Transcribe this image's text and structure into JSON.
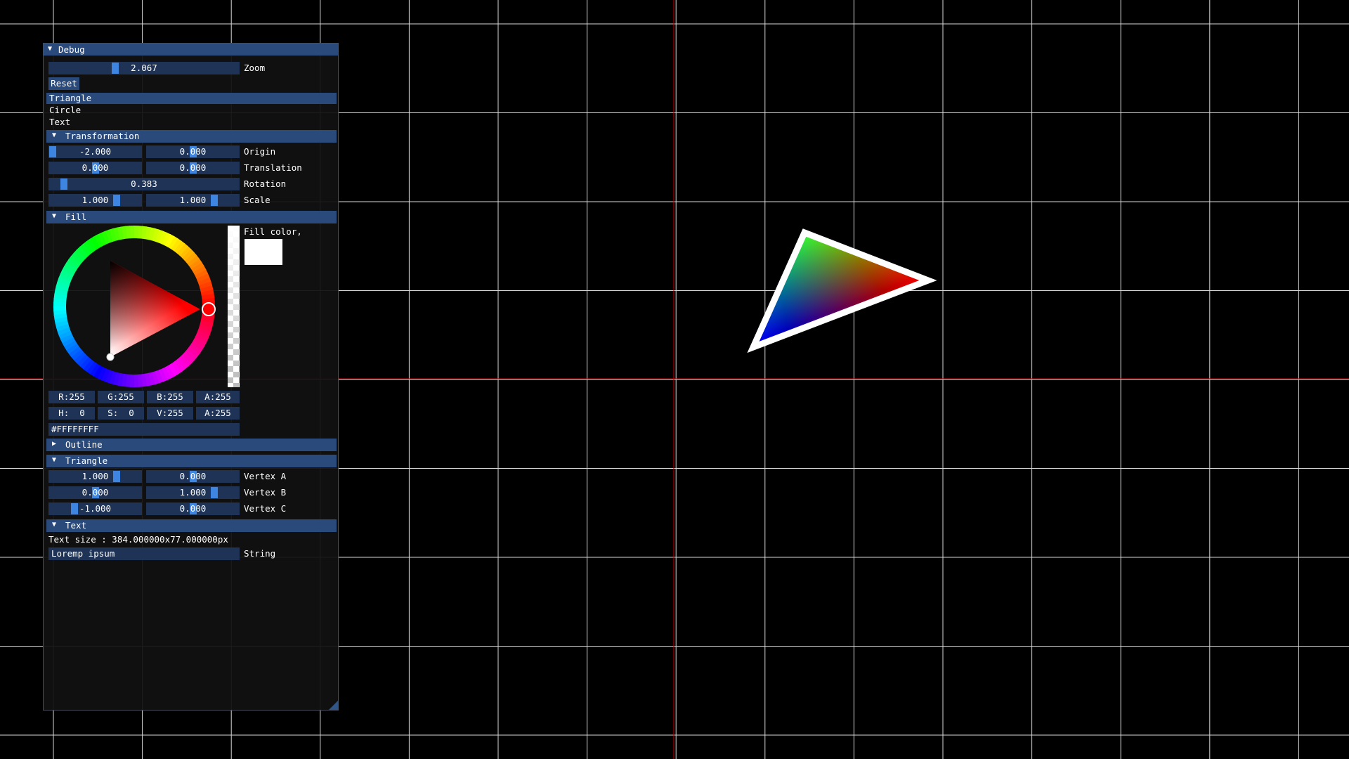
{
  "window": {
    "title": "Debug"
  },
  "zoom": {
    "value": "2.067",
    "label": "Zoom",
    "fraction": 0.28
  },
  "reset_label": "Reset",
  "shape_list": {
    "items": [
      "Triangle",
      "Circle",
      "Text"
    ],
    "selected": 0
  },
  "transformation": {
    "title": "Transformation",
    "origin": {
      "x": "-2.000",
      "y": "0.000",
      "label": "Origin"
    },
    "translation": {
      "x": "0.000",
      "y": "0.000",
      "label": "Translation"
    },
    "rotation": {
      "value": "0.383",
      "label": "Rotation"
    },
    "scale": {
      "x": "1.000",
      "y": "1.000",
      "label": "Scale"
    }
  },
  "fill": {
    "title": "Fill",
    "color_label": "Fill color,",
    "swatch_color": "#FFFFFF",
    "rgba": [
      "R:255",
      "G:255",
      "B:255",
      "A:255"
    ],
    "hsva": [
      "H:  0",
      "S:  0",
      "V:255",
      "A:255"
    ],
    "hex": "#FFFFFFFF"
  },
  "outline": {
    "title": "Outline"
  },
  "triangle": {
    "title": "Triangle",
    "vertex_a": {
      "x": "1.000",
      "y": "0.000",
      "label": "Vertex A"
    },
    "vertex_b": {
      "x": "0.000",
      "y": "1.000",
      "label": "Vertex B"
    },
    "vertex_c": {
      "x": "-1.000",
      "y": "0.000",
      "label": "Vertex C"
    }
  },
  "text_section": {
    "title": "Text",
    "size_text": "Text size : 384.000000x77.000000px",
    "string_value": "Loremp ipsum",
    "string_label": "String"
  },
  "colors": {
    "grid": "#ffffff",
    "axis": "#cc0000",
    "accent": "#3d85e0",
    "header": "#2a4a7c",
    "frame": "#1e3356"
  }
}
